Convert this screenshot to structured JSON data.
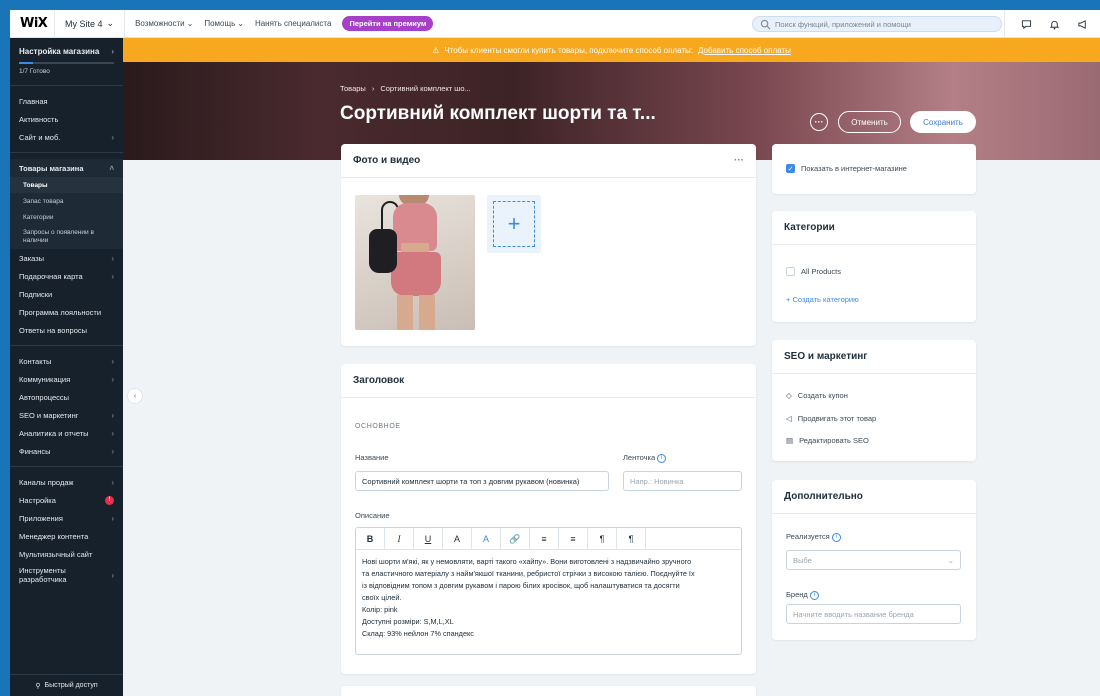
{
  "topbar": {
    "logo": "WiX",
    "site": "My Site 4",
    "nav": [
      "Возможности",
      "Помощь",
      "Нанять специалиста"
    ],
    "upgrade": "Перейти на премиум",
    "search_placeholder": "Поиск функций, приложений и помощи"
  },
  "sidebar": {
    "setup_title": "Настройка магазина",
    "progress_label": "1/7 Готово",
    "progress_fraction": 0.143,
    "group1": [
      "Главная",
      "Активность",
      "Сайт и моб."
    ],
    "store_section": "Товары магазина",
    "store_sub": [
      "Товары",
      "Запас товара",
      "Категории",
      "Запросы о появлении в наличии"
    ],
    "group2": [
      "Заказы",
      "Подарочная карта",
      "Подписки",
      "Программа лояльности",
      "Ответы на вопросы"
    ],
    "group3": [
      "Контакты",
      "Коммуникация",
      "Автопроцессы",
      "SEO и маркетинг",
      "Аналитика и отчеты",
      "Финансы"
    ],
    "group4": [
      "Каналы продаж",
      "Настройка",
      "Приложения",
      "Менеджер контента",
      "Мультиязычный сайт",
      "Инструменты разработчика"
    ],
    "settings_badge": "!",
    "quick_access": "Быстрый доступ"
  },
  "alert": {
    "text": "Чтобы клиенты смогли купить товары, подключите способ оплаты:",
    "link": "Добавить способ оплаты"
  },
  "header": {
    "crumb_root": "Товары",
    "crumb_current": "Сортивний комплект шо...",
    "title": "Сортивний комплект шорти та т...",
    "more": "···",
    "cancel": "Отменить",
    "save": "Сохранить"
  },
  "media": {
    "title": "Фото и видео",
    "add": "+"
  },
  "details": {
    "title": "Заголовок",
    "section": "ОСНОВНОЕ",
    "name_label": "Название",
    "name_value": "Сортивний комплект шорти та топ з довгим рукавом (новинка)",
    "ribbon_label": "Ленточка",
    "ribbon_placeholder": "Напр.: Новинка",
    "desc_label": "Описание",
    "toolbar": [
      "B",
      "I",
      "U",
      "A",
      "A",
      "🔗",
      "≡",
      "≡",
      "¶",
      "¶"
    ],
    "desc_lines": [
      "Нові шорти м'які, як у немовляти, варті такого «хайпу». Вони виготовлені з надзвичайно зручного",
      "та еластичного матеріалу з найм'якшої тканини, ребристої стрічки з високою талією. Поєднуйте їх",
      "із відповідним топом з довгим рукавом і парою білих кросівок, щоб налаштуватися та досягти",
      "своїх цілей.",
      "Колір: pink",
      "Доступні розміри: S,M,L,XL",
      "Склад: 93% нейлон 7% спандекс"
    ]
  },
  "visibility": {
    "label": "Показать в интернет-магазине",
    "checked": true
  },
  "categories": {
    "title": "Категории",
    "item": "All Products",
    "create": "+ Создать категорию"
  },
  "seo": {
    "title": "SEO и маркетинг",
    "items": [
      "Создать купон",
      "Продвигать этот товар",
      "Редактировать SEO"
    ]
  },
  "extra": {
    "title": "Дополнительно",
    "sold_label": "Реализуется",
    "sold_placeholder": "Выбе",
    "brand_label": "Бренд",
    "brand_placeholder": "Начните вводить название бренда"
  },
  "colors": {
    "accent": "#3b8ae6",
    "alert": "#f7a81e",
    "sidebar": "#16212c",
    "upgrade": "#a640c8"
  }
}
